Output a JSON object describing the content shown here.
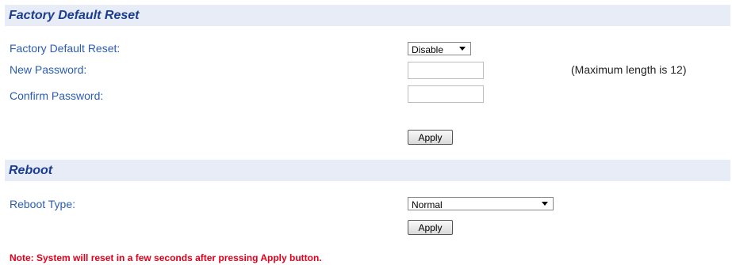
{
  "factory_reset": {
    "title": "Factory Default Reset",
    "reset_label": "Factory Default Reset:",
    "reset_value": "Disable",
    "new_password_label": "New Password:",
    "new_password_value": "",
    "max_length_hint": "(Maximum length is 12)",
    "confirm_password_label": "Confirm Password:",
    "confirm_password_value": "",
    "apply_label": "Apply"
  },
  "reboot": {
    "title": "Reboot",
    "type_label": "Reboot Type:",
    "type_value": "Normal",
    "apply_label": "Apply"
  },
  "note": "Note: System will reset in a few seconds after pressing Apply button."
}
